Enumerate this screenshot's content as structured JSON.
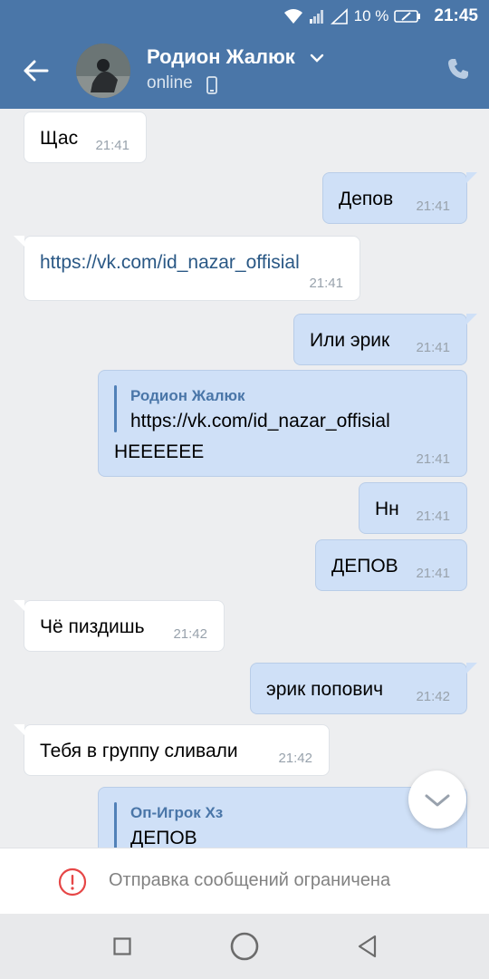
{
  "status_bar": {
    "battery_percent": "10 %",
    "time": "21:45"
  },
  "header": {
    "contact_name": "Родион Жалюк",
    "status": "online"
  },
  "messages": [
    {
      "dir": "in",
      "text": "Щас",
      "time": "21:41"
    },
    {
      "dir": "out",
      "text": "Депов",
      "time": "21:41"
    },
    {
      "dir": "in",
      "text": "https://vk.com/id_nazar_offisial",
      "time": "21:41"
    },
    {
      "dir": "out",
      "text": "Или эрик",
      "time": "21:41"
    },
    {
      "dir": "out",
      "reply_author": "Родион Жалюк",
      "reply_text": "https://vk.com/id_nazar_offisial",
      "text": "НЕЕЕЕЕЕ",
      "time": "21:41"
    },
    {
      "dir": "out",
      "text": "Нн",
      "time": "21:41"
    },
    {
      "dir": "out",
      "text": "ДЕПОВ",
      "time": "21:41"
    },
    {
      "dir": "in",
      "text": "Чё пиздишь",
      "time": "21:42"
    },
    {
      "dir": "out",
      "text": "эрик попович",
      "time": "21:42"
    },
    {
      "dir": "in",
      "text": "Тебя в группу сливали",
      "time": "21:42"
    },
    {
      "dir": "out",
      "reply_author": "Оп-Игрок Хз",
      "reply_text": "ДЕПОВ"
    }
  ],
  "restriction_notice": "Отправка сообщений ограничена",
  "colors": {
    "header": "#4a76a8",
    "incoming_bubble": "#ffffff",
    "outgoing_bubble": "#cfe0f7",
    "background": "#edeef0",
    "warning": "#e64646"
  }
}
